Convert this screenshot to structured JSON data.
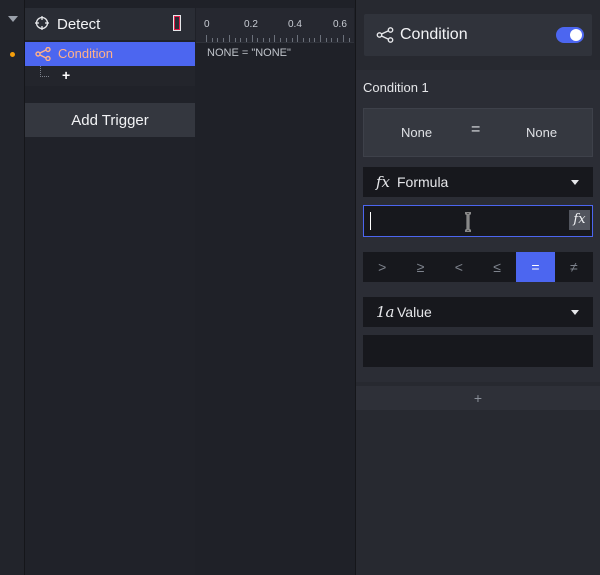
{
  "trigger_panel": {
    "detect_label": "Detect",
    "condition_label": "Condition",
    "add_sub_label": "+",
    "add_trigger_label": "Add Trigger"
  },
  "timeline": {
    "ticks": [
      "0",
      "0.2",
      "0.4",
      "0.6"
    ],
    "expression": "NONE = \"NONE\""
  },
  "right_panel": {
    "header_title": "Condition",
    "toggle_on": true,
    "condition_title": "Condition 1",
    "summary": {
      "lhs": "None",
      "op": "=",
      "rhs": "None"
    },
    "formula_select": {
      "tag": "fx",
      "value": "Formula"
    },
    "formula_input": {
      "value": "",
      "fx_button": "fx"
    },
    "operators": [
      ">",
      "≥",
      "<",
      "≤",
      "=",
      "≠"
    ],
    "active_operator": "=",
    "value_select": {
      "tag": "1a",
      "value": "Value"
    },
    "value_input": {
      "value": ""
    },
    "add_condition_label": "+"
  },
  "colors": {
    "accent": "#4c66f0",
    "condition_text": "#ffb18a",
    "dot": "#f59e0b"
  },
  "icons": [
    "crosshair-icon",
    "branch-icon",
    "flag-icon",
    "chevron-down-icon",
    "ibeam-cursor-icon"
  ]
}
